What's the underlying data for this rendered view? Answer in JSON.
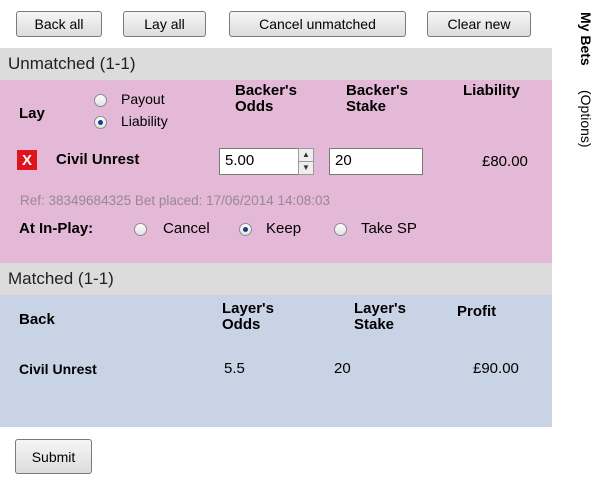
{
  "toolbar": {
    "back_all": "Back all",
    "lay_all": "Lay all",
    "cancel_unmatched": "Cancel unmatched",
    "clear_new": "Clear new"
  },
  "unmatched": {
    "title": "Unmatched (1-1)",
    "side_label": "Lay",
    "mode_options": [
      {
        "label": "Payout",
        "selected": false
      },
      {
        "label": "Liability",
        "selected": true
      }
    ],
    "col_odds": "Backer's Odds",
    "col_stake": "Backer's Stake",
    "col_liability": "Liability",
    "bet": {
      "remove_icon": "X",
      "selection": "Civil Unrest",
      "odds": "5.00",
      "stake": "20",
      "liability": "£80.00",
      "ref": "Ref: 38349684325 Bet placed: 17/06/2014 14:08:03"
    },
    "inplay_label": "At In-Play:",
    "inplay_options": [
      {
        "label": "Cancel",
        "selected": false
      },
      {
        "label": "Keep",
        "selected": true
      },
      {
        "label": "Take SP",
        "selected": false
      }
    ]
  },
  "matched": {
    "title": "Matched (1-1)",
    "side_label": "Back",
    "col_odds": "Layer's Odds",
    "col_stake": "Layer's Stake",
    "col_profit": "Profit",
    "bet": {
      "selection": "Civil Unrest",
      "odds": "5.5",
      "stake": "20",
      "profit": "£90.00"
    }
  },
  "submit_label": "Submit",
  "sidebar": {
    "my_bets": "My Bets",
    "options": "(Options)"
  },
  "colors": {
    "unmatched_bg": "#e4b9d7",
    "matched_bg": "#c9d3e6",
    "section_header_bg": "#dcdcdc",
    "remove_red": "#e0141e"
  }
}
